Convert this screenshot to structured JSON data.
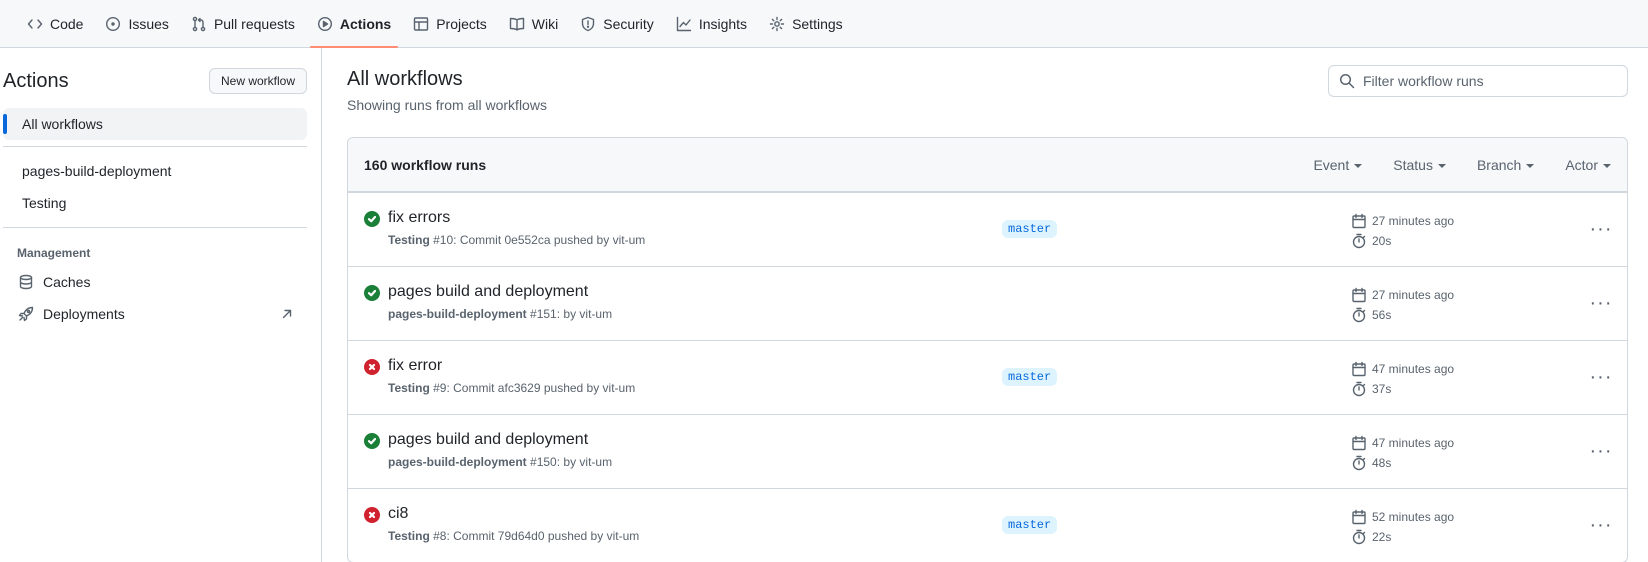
{
  "topnav": {
    "tabs": [
      {
        "label": "Code",
        "icon": "code-icon"
      },
      {
        "label": "Issues",
        "icon": "issue-opened-icon"
      },
      {
        "label": "Pull requests",
        "icon": "git-pull-request-icon"
      },
      {
        "label": "Actions",
        "icon": "play-icon",
        "active": true
      },
      {
        "label": "Projects",
        "icon": "table-icon"
      },
      {
        "label": "Wiki",
        "icon": "book-icon"
      },
      {
        "label": "Security",
        "icon": "shield-icon"
      },
      {
        "label": "Insights",
        "icon": "graph-icon"
      },
      {
        "label": "Settings",
        "icon": "gear-icon"
      }
    ]
  },
  "sidebar": {
    "title": "Actions",
    "new_workflow_label": "New workflow",
    "all_workflows_label": "All workflows",
    "workflows": [
      "pages-build-deployment",
      "Testing"
    ],
    "management_label": "Management",
    "management_items": [
      {
        "label": "Caches",
        "icon": "database-icon"
      },
      {
        "label": "Deployments",
        "icon": "rocket-icon",
        "trailing_icon": "arrow-up-right-icon"
      }
    ]
  },
  "main": {
    "title": "All workflows",
    "subtitle": "Showing runs from all workflows",
    "filter_placeholder": "Filter workflow runs",
    "run_count": "160 workflow runs",
    "filters": [
      "Event",
      "Status",
      "Branch",
      "Actor"
    ],
    "runs": [
      {
        "title": "fix errors",
        "status": "success",
        "workflow": "Testing",
        "meta": "#10: Commit 0e552ca pushed by vit-um",
        "branch": "master",
        "time": "27 minutes ago",
        "duration": "20s"
      },
      {
        "title": "pages build and deployment",
        "status": "success",
        "workflow": "pages-build-deployment",
        "meta": "#151: by vit-um",
        "branch": "",
        "time": "27 minutes ago",
        "duration": "56s"
      },
      {
        "title": "fix error",
        "status": "failure",
        "workflow": "Testing",
        "meta": "#9: Commit afc3629 pushed by vit-um",
        "branch": "master",
        "time": "47 minutes ago",
        "duration": "37s"
      },
      {
        "title": "pages build and deployment",
        "status": "success",
        "workflow": "pages-build-deployment",
        "meta": "#150: by vit-um",
        "branch": "",
        "time": "47 minutes ago",
        "duration": "48s"
      },
      {
        "title": "ci8",
        "status": "failure",
        "workflow": "Testing",
        "meta": "#8: Commit 79d64d0 pushed by vit-um",
        "branch": "master",
        "time": "52 minutes ago",
        "duration": "22s"
      }
    ]
  },
  "colors": {
    "success": "#1a7f37",
    "failure": "#cf222e",
    "active_tab_underline": "#fd8c73",
    "branch_bg": "#ddf4ff",
    "branch_fg": "#0969da"
  }
}
